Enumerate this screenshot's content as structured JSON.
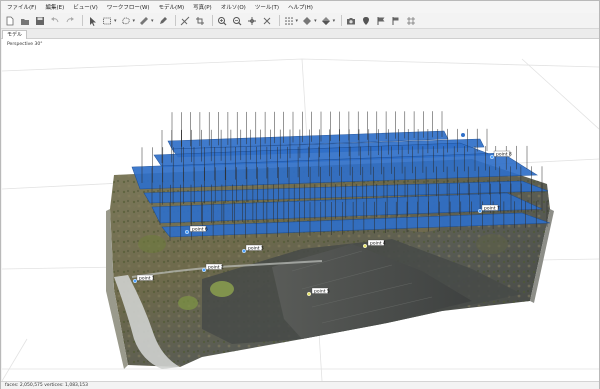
{
  "menu": [
    "ファイル(F)",
    "編集(E)",
    "ビュー(V)",
    "ワークフロー(W)",
    "モデル(M)",
    "写真(P)",
    "オルソ(O)",
    "ツール(T)",
    "ヘルプ(H)"
  ],
  "toolbar": {
    "icons": [
      "new-icon",
      "open-icon",
      "save-icon",
      "undo-icon",
      "redo-icon",
      "pointer-icon",
      "rectangle-select-icon",
      "free-select-icon",
      "ruler-icon",
      "draw-icon",
      "eraser-icon",
      "crop-icon",
      "rotate-icon",
      "zoom-in-icon",
      "zoom-out-icon",
      "move-icon",
      "reset-view-icon",
      "points-icon",
      "mesh-icon",
      "texture-icon",
      "camera-icon",
      "markers-icon",
      "flag-icon",
      "flags-icon",
      "grid-icon"
    ]
  },
  "tabs": [
    "モデル"
  ],
  "viewport": {
    "projection_label": "Perspective 30°",
    "markers": [
      "point 1",
      "point 2",
      "point 3",
      "point 4",
      "point 5",
      "point 6",
      "point 7",
      "point 8"
    ]
  },
  "status": {
    "text": "faces: 2,050,575 vertices: 1,083,153"
  },
  "colors": {
    "camera_plane": "#2f6fc8",
    "camera_plane_edge": "#1b4f9a",
    "terrain_dark": "#4a4e48",
    "road": "#cfd1cf"
  }
}
